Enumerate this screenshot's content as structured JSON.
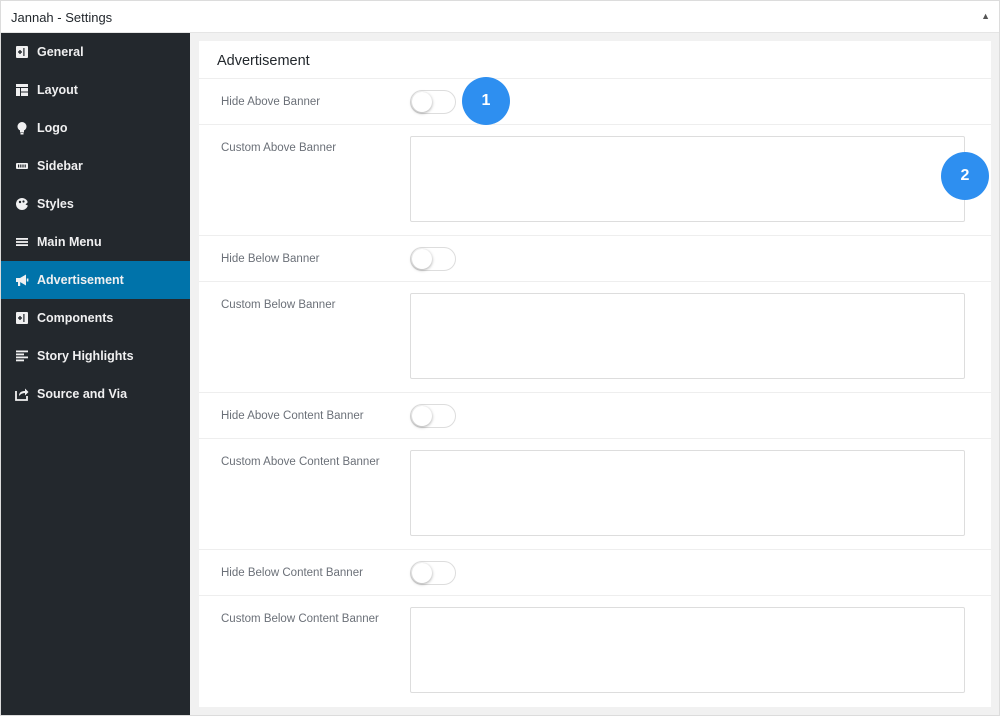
{
  "window": {
    "title": "Jannah - Settings",
    "collapse_icon": "triangle-up-icon"
  },
  "sidebar": {
    "items": [
      {
        "label": "General",
        "icon": "general-icon",
        "active": false
      },
      {
        "label": "Layout",
        "icon": "layout-icon",
        "active": false
      },
      {
        "label": "Logo",
        "icon": "lightbulb-icon",
        "active": false
      },
      {
        "label": "Sidebar",
        "icon": "sidebar-icon",
        "active": false
      },
      {
        "label": "Styles",
        "icon": "palette-icon",
        "active": false
      },
      {
        "label": "Main Menu",
        "icon": "menu-icon",
        "active": false
      },
      {
        "label": "Advertisement",
        "icon": "megaphone-icon",
        "active": true
      },
      {
        "label": "Components",
        "icon": "components-icon",
        "active": false
      },
      {
        "label": "Story Highlights",
        "icon": "story-icon",
        "active": false
      },
      {
        "label": "Source and Via",
        "icon": "share-icon",
        "active": false
      }
    ],
    "active_color": "#0073aa"
  },
  "panel": {
    "title": "Advertisement",
    "rows": [
      {
        "label": "Hide Above Banner",
        "type": "toggle",
        "on": false
      },
      {
        "label": "Custom Above Banner",
        "type": "textarea",
        "value": ""
      },
      {
        "label": "Hide Below Banner",
        "type": "toggle",
        "on": false
      },
      {
        "label": "Custom Below Banner",
        "type": "textarea",
        "value": ""
      },
      {
        "label": "Hide Above Content Banner",
        "type": "toggle",
        "on": false
      },
      {
        "label": "Custom Above Content Banner",
        "type": "textarea",
        "value": ""
      },
      {
        "label": "Hide Below Content Banner",
        "type": "toggle",
        "on": false
      },
      {
        "label": "Custom Below Content Banner",
        "type": "textarea",
        "value": ""
      }
    ]
  },
  "annotations": [
    {
      "number": "1"
    },
    {
      "number": "2"
    }
  ],
  "colors": {
    "sidebar_bg": "#23282d",
    "badge": "#2e8ff0"
  }
}
